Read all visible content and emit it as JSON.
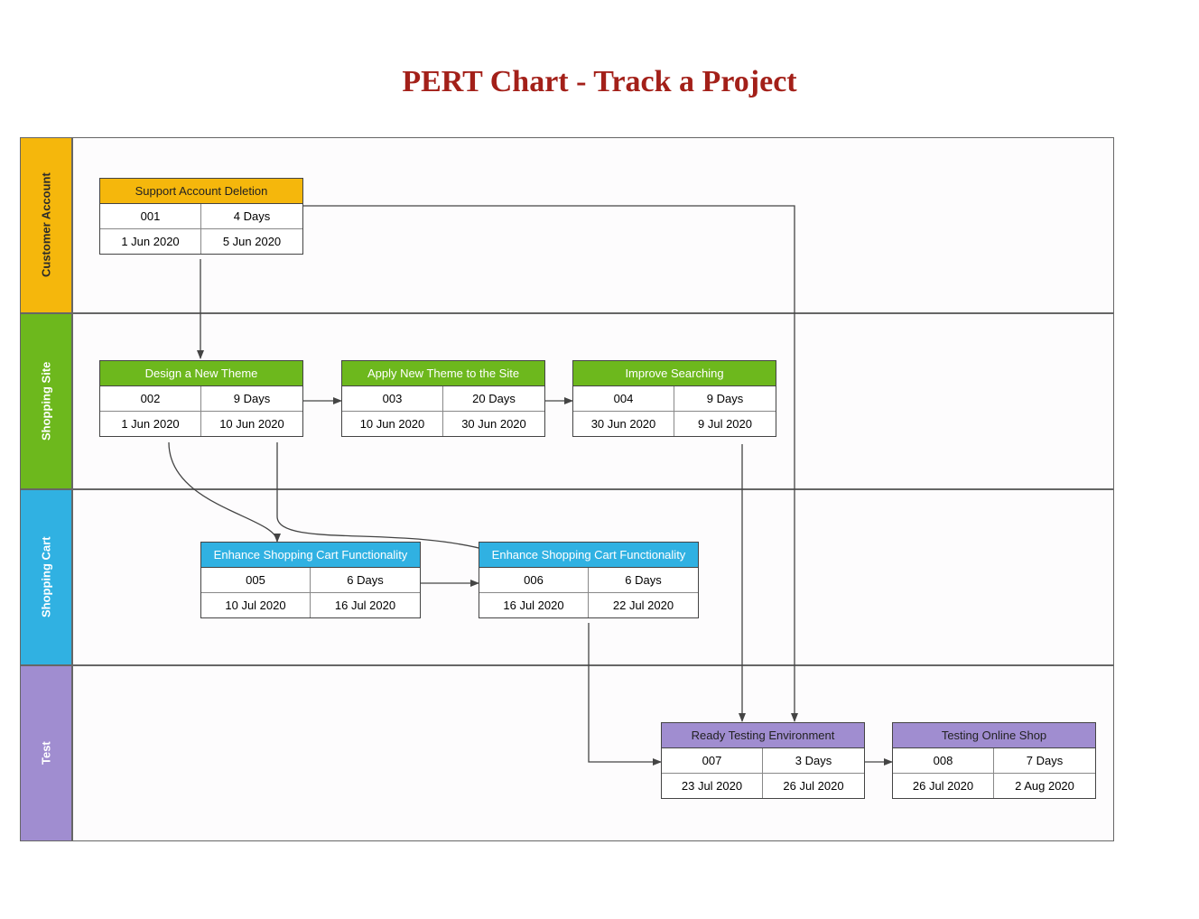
{
  "title": "PERT Chart - Track a Project",
  "lanes": [
    {
      "label": "Customer Account"
    },
    {
      "label": "Shopping Site"
    },
    {
      "label": "Shopping Cart"
    },
    {
      "label": "Test"
    }
  ],
  "tasks": {
    "t001": {
      "title": "Support Account Deletion",
      "id": "001",
      "duration": "4 Days",
      "start": "1 Jun 2020",
      "end": "5 Jun 2020"
    },
    "t002": {
      "title": "Design a New Theme",
      "id": "002",
      "duration": "9 Days",
      "start": "1 Jun 2020",
      "end": "10 Jun 2020"
    },
    "t003": {
      "title": "Apply New Theme to the Site",
      "id": "003",
      "duration": "20 Days",
      "start": "10 Jun 2020",
      "end": "30 Jun 2020"
    },
    "t004": {
      "title": "Improve Searching",
      "id": "004",
      "duration": "9 Days",
      "start": "30 Jun 2020",
      "end": "9 Jul 2020"
    },
    "t005": {
      "title": "Enhance Shopping Cart Functionality",
      "id": "005",
      "duration": "6 Days",
      "start": "10 Jul 2020",
      "end": "16 Jul 2020"
    },
    "t006": {
      "title": "Enhance Shopping Cart Functionality",
      "id": "006",
      "duration": "6 Days",
      "start": "16 Jul 2020",
      "end": "22 Jul 2020"
    },
    "t007": {
      "title": "Ready Testing Environment",
      "id": "007",
      "duration": "3 Days",
      "start": "23 Jul 2020",
      "end": "26 Jul 2020"
    },
    "t008": {
      "title": "Testing Online Shop",
      "id": "008",
      "duration": "7 Days",
      "start": "26 Jul 2020",
      "end": "2 Aug 2020"
    }
  }
}
